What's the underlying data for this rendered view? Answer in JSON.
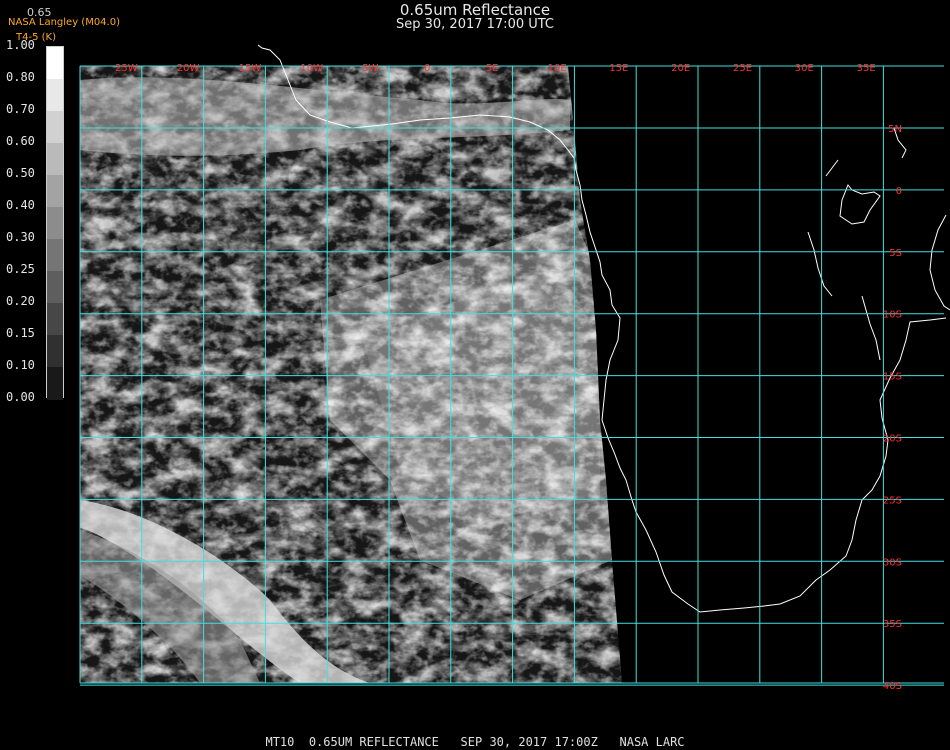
{
  "header": {
    "title": "0.65um Reflectance",
    "time": "Sep 30, 2017 17:00 UTC",
    "source": "NASA Langley (M04.0)",
    "product": "T4-5 (K)",
    "band": "0.65"
  },
  "colorbar": {
    "ticks": [
      "1.00",
      "0.80",
      "0.70",
      "0.60",
      "0.50",
      "0.40",
      "0.30",
      "0.25",
      "0.20",
      "0.15",
      "0.10",
      "0.00"
    ]
  },
  "map": {
    "lon_labels": [
      "25W",
      "20W",
      "15W",
      "10W",
      "5W",
      "0",
      "5E",
      "10E",
      "15E",
      "20E",
      "25E",
      "30E",
      "35E"
    ],
    "lat_labels": [
      "5N",
      "0",
      "5S",
      "10S",
      "15S",
      "20S",
      "25S",
      "30S",
      "35S",
      "40S"
    ],
    "grid_color": "#40e0e0",
    "label_color": "#ff3030",
    "coast_color": "#ffffff"
  },
  "footer": {
    "text": "MT10  0.65UM REFLECTANCE   SEP 30, 2017 17:00Z   NASA LARC"
  }
}
